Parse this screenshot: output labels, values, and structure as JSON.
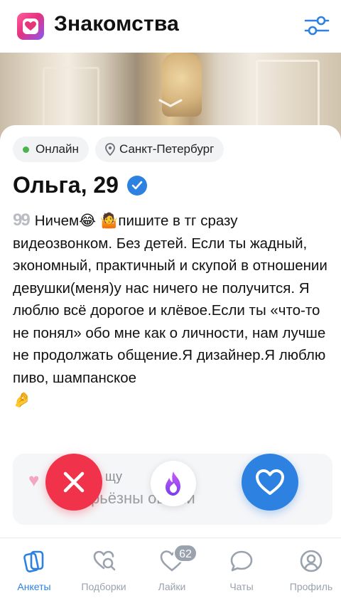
{
  "header": {
    "title": "Знакомства",
    "logo_icon": "heart-logo-icon",
    "filter_icon": "sliders-icon"
  },
  "profile": {
    "chips": {
      "online": "Онлайн",
      "city": "Санкт-Петербург"
    },
    "name_age": "Ольга, 29",
    "verified": true,
    "bio": {
      "quote_mark": "99",
      "line1_a": "Ничем",
      "emoji1": "😂",
      "emoji2": "🤷",
      "line1_b": "пишите в тг сразу",
      "rest": "видеозвонком. Без детей. Если ты жадный, экономный, практичный и скупой в отношении девушки(меня)у нас ничего не получится. Я люблю всё дорогое и клёвое.Если ты «что-то не понял» обо мне как о личности, нам лучше не продолжать общение.Я дизайнер.Я люблю пиво, шампанское",
      "emoji_end": "🤌"
    },
    "info": {
      "title": "щу",
      "value": "рьёзны   ошени"
    }
  },
  "actions": {
    "dislike_icon": "close-icon",
    "super_icon": "flame-icon",
    "like_icon": "heart-icon"
  },
  "tabs": [
    {
      "label": "Анкеты",
      "icon": "cards-icon",
      "active": true
    },
    {
      "label": "Подборки",
      "icon": "heart-search-icon",
      "active": false
    },
    {
      "label": "Лайки",
      "icon": "heart-icon",
      "badge": "62",
      "active": false
    },
    {
      "label": "Чаты",
      "icon": "chat-bubble-icon",
      "active": false
    },
    {
      "label": "Профиль",
      "icon": "profile-icon",
      "active": false
    }
  ],
  "colors": {
    "accent": "#2d81e0",
    "dislike": "#f0334b",
    "online": "#4bb34b",
    "inactive": "#99a2ad"
  }
}
